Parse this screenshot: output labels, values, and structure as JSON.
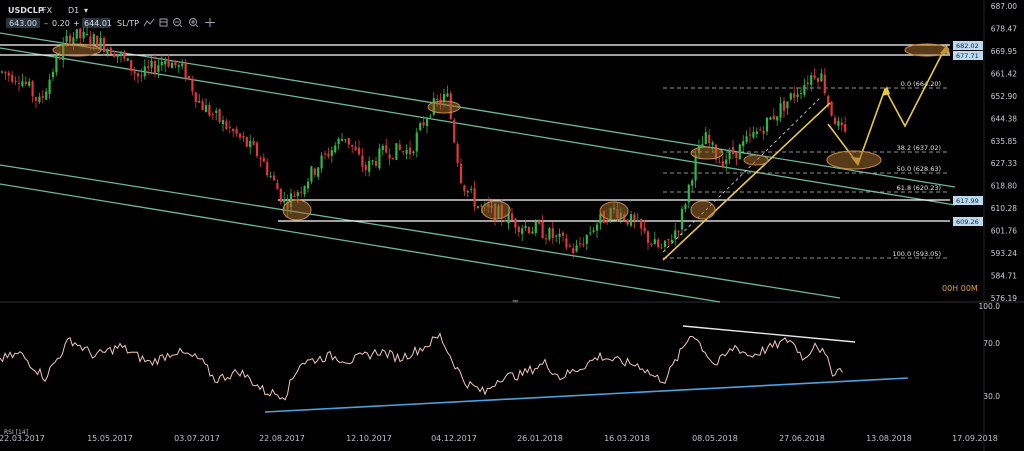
{
  "toolbar": {
    "symbol": "USDCLP",
    "fx_tag": "FX",
    "timeframe": "D1",
    "bid": "643.00",
    "spread": "0.20",
    "ask": "644.01",
    "sltp": "SL/TP",
    "icons": [
      "trend-icon",
      "chart-type-icon",
      "zoom-out-icon",
      "zoom-in-icon",
      "crosshair-icon"
    ]
  },
  "countdown": "00H 00M",
  "price_axis": {
    "ticks": [
      "687.00",
      "678.47",
      "669.95",
      "661.42",
      "652.90",
      "644.38",
      "635.85",
      "627.33",
      "618.80",
      "610.28",
      "601.76",
      "593.24",
      "584.71",
      "576.19"
    ]
  },
  "rsi_axis": {
    "ticks": [
      "100.0",
      "70.0",
      "30.0"
    ],
    "label": "RSI [14]"
  },
  "date_axis": {
    "ticks": [
      "22.03.2017",
      "15.05.2017",
      "03.07.2017",
      "22.08.2017",
      "12.10.2017",
      "04.12.2017",
      "26.01.2018",
      "16.03.2018",
      "08.05.2018",
      "27.06.2018",
      "13.08.2018",
      "17.09.2018"
    ]
  },
  "levels": [
    {
      "label": "682.02",
      "color": "#bcd9ee"
    },
    {
      "label": "677.71",
      "color": "#bcd9ee"
    },
    {
      "label": "617.99",
      "color": "#bcd9ee"
    },
    {
      "label": "609.26",
      "color": "#bcd9ee"
    }
  ],
  "fib": [
    {
      "label": "0.0 (664.20)"
    },
    {
      "label": "38.2 (637.02)"
    },
    {
      "label": "50.0 (628.63)"
    },
    {
      "label": "61.8 (620.23)"
    },
    {
      "label": "100.0 (593.05)"
    }
  ],
  "colors": {
    "bull": "#2eb84a",
    "bear": "#e2353c",
    "channel": "#7fd9b3",
    "trend": "#e8c840",
    "rsi": "#f2c7b8",
    "rsi_support": "#4aa3e0"
  },
  "chart_data": {
    "type": "candlestick",
    "instrument": "USDCLP",
    "timeframe": "D1",
    "price_axis_range": [
      576.19,
      687.0
    ],
    "horizontal_levels": [
      682.02,
      677.71,
      617.99,
      609.26
    ],
    "fibonacci_levels": [
      {
        "ratio": 0.0,
        "price": 664.2
      },
      {
        "ratio": 38.2,
        "price": 637.02
      },
      {
        "ratio": 50.0,
        "price": 628.63
      },
      {
        "ratio": 61.8,
        "price": 620.23
      },
      {
        "ratio": 100.0,
        "price": 593.05
      }
    ],
    "close_series_approx": {
      "x": [
        "22.03.2017",
        "15.05.2017",
        "03.07.2017",
        "22.08.2017",
        "12.10.2017",
        "04.12.2017",
        "26.01.2018",
        "16.03.2018",
        "08.05.2018",
        "27.06.2018"
      ],
      "y": [
        662,
        675,
        664,
        615,
        634,
        655,
        608,
        610,
        625,
        665
      ]
    },
    "rsi_series_approx": {
      "x": [
        "22.03.2017",
        "15.05.2017",
        "03.07.2017",
        "22.08.2017",
        "12.10.2017",
        "04.12.2017",
        "26.01.2018",
        "16.03.2018",
        "08.05.2018",
        "27.06.2018"
      ],
      "y": [
        55,
        60,
        58,
        27,
        55,
        75,
        28,
        50,
        78,
        50
      ]
    },
    "rsi_axis_range": [
      0,
      100
    ],
    "grid": false
  }
}
